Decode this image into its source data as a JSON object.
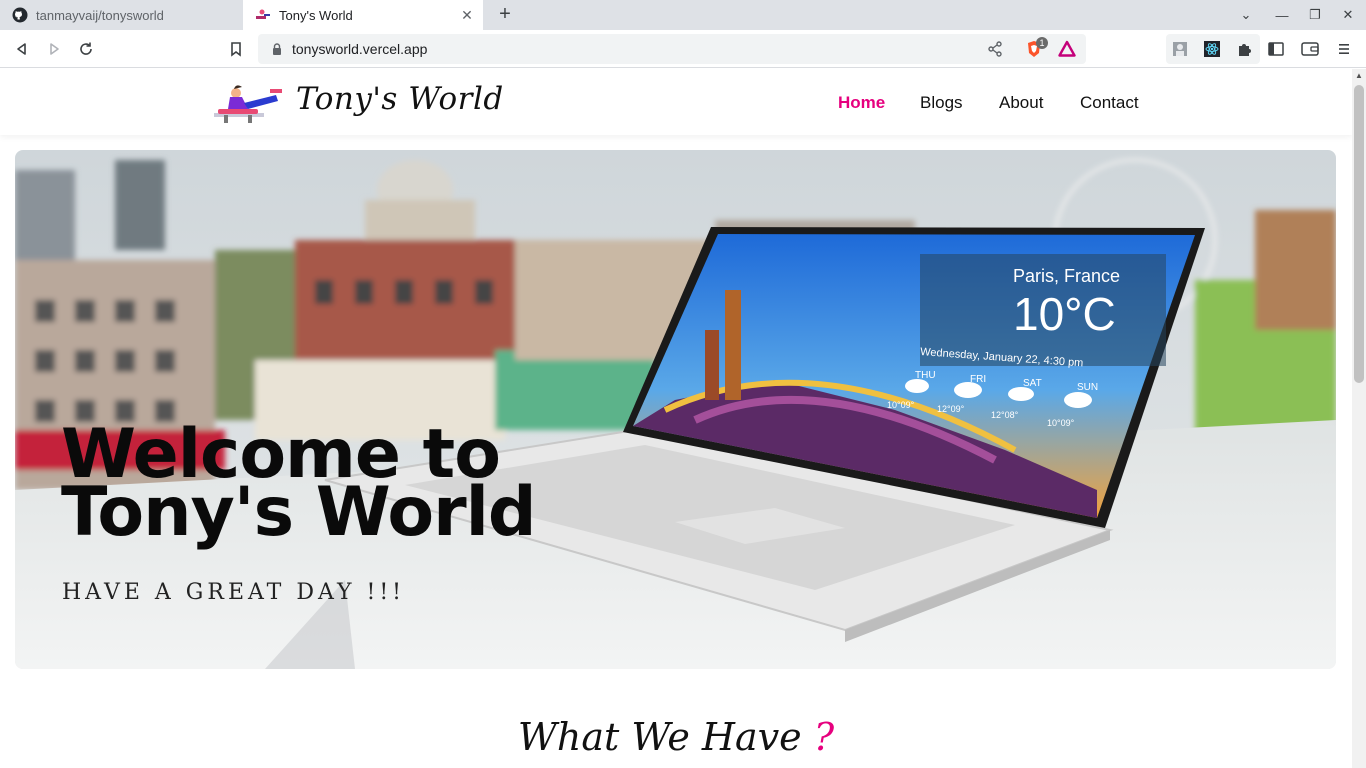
{
  "browser": {
    "tabs": [
      {
        "title": "tanmayvaij/tonysworld",
        "favicon": "github-icon",
        "active": false
      },
      {
        "title": "Tony's World",
        "favicon": "tonys-world-icon",
        "active": true
      }
    ],
    "url": "tonysworld.vercel.app",
    "brave_shield_count": "1"
  },
  "site": {
    "brand": "Tony's World",
    "nav": [
      {
        "label": "Home",
        "active": true
      },
      {
        "label": "Blogs",
        "active": false
      },
      {
        "label": "About",
        "active": false
      },
      {
        "label": "Contact",
        "active": false
      }
    ],
    "accent": "#e6007e"
  },
  "hero": {
    "title_line1": "Welcome to",
    "title_line2": "Tony's World",
    "subtitle": "HAVE A GREAT DAY !!!",
    "laptop_screen": {
      "city": "Paris, France",
      "temp": "10°C",
      "date": "Wednesday, January 22, 4:30 pm",
      "days": [
        "THU",
        "FRI",
        "SAT",
        "SUN"
      ],
      "temps": [
        "10°09°",
        "12°09°",
        "12°08°",
        "10°09°"
      ]
    }
  },
  "section": {
    "title": "What We Have",
    "mark": "?"
  }
}
